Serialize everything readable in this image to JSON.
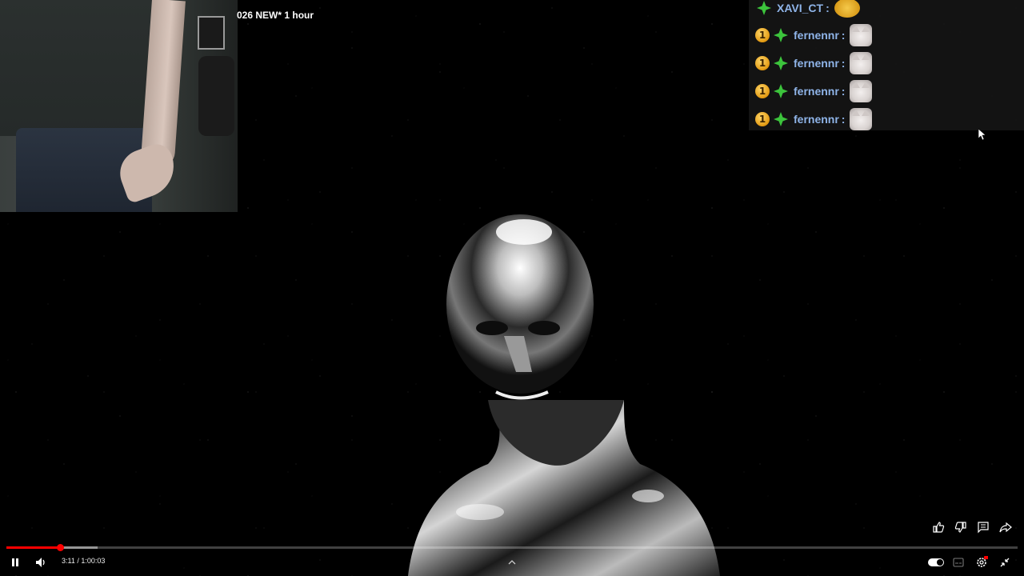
{
  "video": {
    "title": "026 NEW* 1 hour",
    "current_time": "3:11",
    "duration": "1:00:03",
    "time_display": "3:11 / 1:00:03",
    "progress_fraction": 0.053,
    "buffered_fraction": 0.09
  },
  "chat": {
    "messages": [
      {
        "user": "XAVI_CT",
        "badges": [
          "star-badge-icon"
        ],
        "emote": "pepe-emote"
      },
      {
        "user": "fernennr",
        "badges": [
          "one-badge-icon",
          "star-badge-icon"
        ],
        "emote": "cat-emote"
      },
      {
        "user": "fernennr",
        "badges": [
          "one-badge-icon",
          "star-badge-icon"
        ],
        "emote": "cat-emote"
      },
      {
        "user": "fernennr",
        "badges": [
          "one-badge-icon",
          "star-badge-icon"
        ],
        "emote": "cat-emote"
      },
      {
        "user": "fernennr",
        "badges": [
          "one-badge-icon",
          "star-badge-icon"
        ],
        "emote": "cat-emote"
      }
    ],
    "badge_one_label": "1"
  },
  "actions": [
    "like-icon",
    "dislike-icon",
    "comments-icon",
    "share-icon"
  ],
  "controls": {
    "left": [
      "pause-icon",
      "volume-icon"
    ],
    "right": [
      "autoplay-toggle",
      "subtitles-icon",
      "settings-icon",
      "exit-fullscreen-icon"
    ],
    "center": "chevron-up-icon"
  },
  "colors": {
    "progress_played": "#ff0000",
    "chat_username": "#8fb4e8",
    "chat_star_badge": "#3cc43c"
  }
}
